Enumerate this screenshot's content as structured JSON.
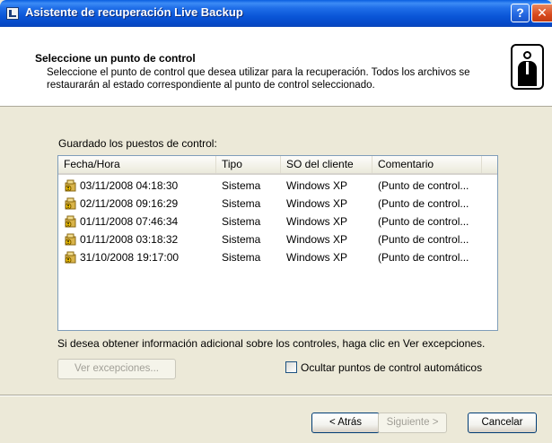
{
  "window": {
    "title": "Asistente de recuperación Live Backup",
    "help_label": "?",
    "close_label": "✕"
  },
  "header": {
    "title": "Seleccione un punto de control",
    "description": "Seleccione el punto de control que desea utilizar para la recuperación. Todos los archivos se restaurarán al estado correspondiente al punto de control seleccionado."
  },
  "checkpoints": {
    "group_label": "Guardado los puestos de control:",
    "columns": [
      "Fecha/Hora",
      "Tipo",
      "SO del cliente",
      "Comentario"
    ],
    "rows": [
      {
        "date": "03/11/2008 04:18:30",
        "type": "Sistema",
        "os": "Windows XP",
        "comment": "(Punto de control..."
      },
      {
        "date": "02/11/2008 09:16:29",
        "type": "Sistema",
        "os": "Windows XP",
        "comment": "(Punto de control..."
      },
      {
        "date": "01/11/2008 07:46:34",
        "type": "Sistema",
        "os": "Windows XP",
        "comment": "(Punto de control..."
      },
      {
        "date": "01/11/2008 03:18:32",
        "type": "Sistema",
        "os": "Windows XP",
        "comment": "(Punto de control..."
      },
      {
        "date": "31/10/2008 19:17:00",
        "type": "Sistema",
        "os": "Windows XP",
        "comment": "(Punto de control..."
      }
    ]
  },
  "info_text": "Si desea obtener información adicional sobre los controles, haga clic en Ver excepciones.",
  "ver_excepciones_label": "Ver excepciones...",
  "hide_auto_label": "Ocultar puntos de control automáticos",
  "hide_auto_checked": false,
  "nav": {
    "back_label": "< Atrás",
    "next_label": "Siguiente >",
    "cancel_label": "Cancelar"
  }
}
